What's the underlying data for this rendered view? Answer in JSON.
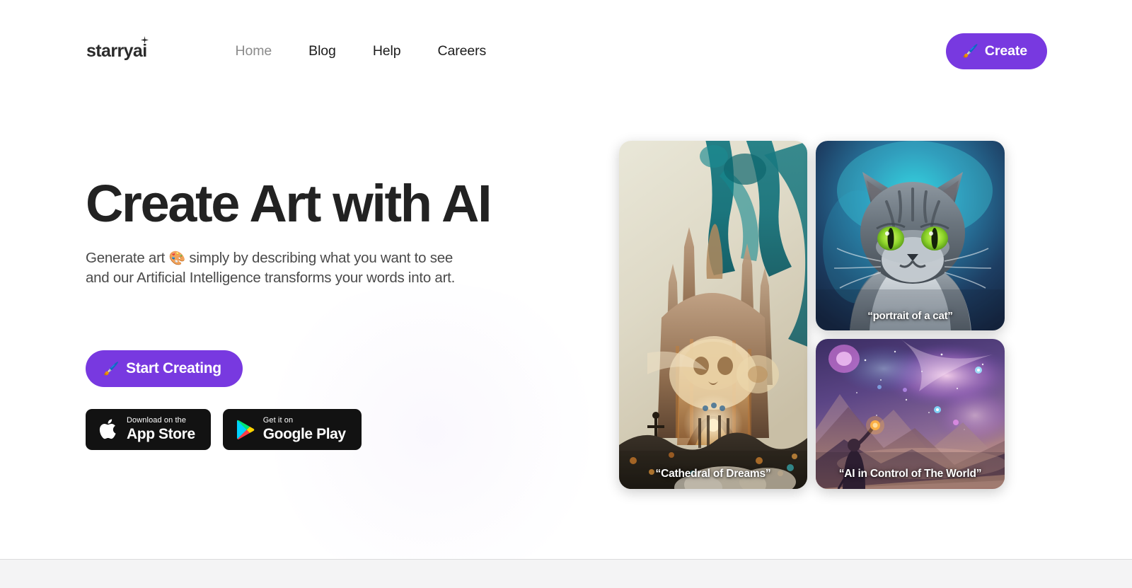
{
  "brand": {
    "logo_text": "starryai",
    "logo_icon": "sparkle-icon",
    "accent_color": "#7839e0",
    "text_color": "#222222"
  },
  "nav": {
    "links": [
      {
        "label": "Home",
        "active": true
      },
      {
        "label": "Blog",
        "active": false
      },
      {
        "label": "Help",
        "active": false
      },
      {
        "label": "Careers",
        "active": false
      }
    ],
    "create_button": {
      "label": "Create",
      "emoji": "🖌️",
      "icon": "paintbrush-icon"
    }
  },
  "hero": {
    "headline": "Create Art with AI",
    "subhead_line1_before": "Generate art ",
    "subhead_emoji": "🎨",
    "subhead_line1_after": " simply by describing what you want to see",
    "subhead_line2": "and our Artificial Intelligence transforms your words into art.",
    "cta": {
      "label": "Start Creating",
      "emoji": "🖌️",
      "icon": "paintbrush-icon"
    },
    "stores": [
      {
        "icon": "apple-logo-icon",
        "top_line": "Download on the",
        "bottom_line": "App Store"
      },
      {
        "icon": "google-play-icon",
        "top_line": "Get it on",
        "bottom_line": "Google Play"
      }
    ]
  },
  "gallery": {
    "cards": [
      {
        "caption": "“Cathedral of Dreams”",
        "name": "gallery-card-cathedral",
        "description": "Ornate golden cathedral with teal colossal figures above a cream sky"
      },
      {
        "caption": "“portrait of a cat”",
        "name": "gallery-card-cat",
        "description": "Grey tabby cat with bright green eyes on a blue teal background"
      },
      {
        "caption": "“AI in Control of The World”",
        "name": "gallery-card-cosmos",
        "description": "Purple nebula sky over mountain range with a robed figure holding a torch"
      }
    ]
  }
}
